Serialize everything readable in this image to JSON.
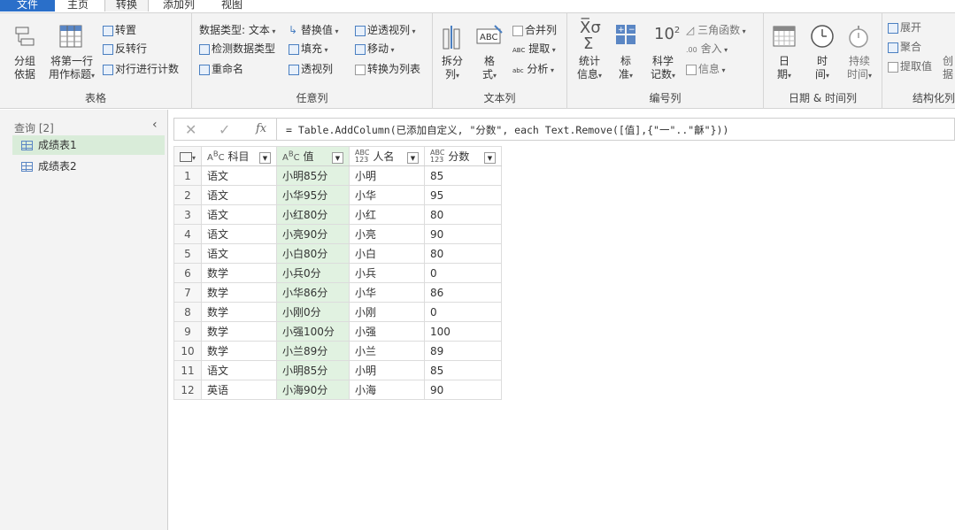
{
  "menu": {
    "file": "文件",
    "home": "主页",
    "transform": "转换",
    "add_column": "添加列",
    "view": "视图"
  },
  "ribbon": {
    "table_group": {
      "label": "表格",
      "group_by_1": "分组",
      "group_by_2": "依据",
      "first_row_1": "将第一行",
      "first_row_2": "用作标题",
      "transpose": "转置",
      "reverse_rows": "反转行",
      "count_rows": "对行进行计数"
    },
    "any_column_group": {
      "label": "任意列",
      "data_type": "数据类型: 文本",
      "detect_type": "检测数据类型",
      "rename": "重命名",
      "replace_values": "替换值",
      "fill": "填充",
      "pivot": "透视列",
      "unpivot": "逆透视列",
      "move": "移动",
      "to_list": "转换为列表"
    },
    "text_column_group": {
      "label": "文本列",
      "split_1": "拆分",
      "split_2": "列",
      "format_1": "格",
      "format_2": "式",
      "merge": "合并列",
      "extract": "提取",
      "parse": "分析"
    },
    "number_column_group": {
      "label": "编号列",
      "stats_1": "统计",
      "stats_2": "信息",
      "standard_1": "标",
      "standard_2": "准",
      "scientific_1": "科学",
      "scientific_2": "记数",
      "trig": "三角函数",
      "rounding": "舍入",
      "info": "信息"
    },
    "datetime_group": {
      "label": "日期 & 时间列",
      "date_1": "日",
      "date_2": "期",
      "time_1": "时",
      "time_2": "间",
      "duration_1": "持续",
      "duration_2": "时间"
    },
    "structured_group": {
      "label": "结构化列",
      "expand": "展开",
      "aggregate": "聚合",
      "extract_values": "提取值",
      "create_1": "创",
      "create_2": "据"
    }
  },
  "queries": {
    "header": "查询 [2]",
    "items": [
      "成绩表1",
      "成绩表2"
    ]
  },
  "formula": {
    "text": "= Table.AddColumn(已添加自定义, \"分数\", each Text.Remove([值],{\"一\"..\"龢\"}))"
  },
  "table": {
    "columns": [
      {
        "name": "科目",
        "type": "ABC"
      },
      {
        "name": "值",
        "type": "ABC"
      },
      {
        "name": "人名",
        "type": "ABC123"
      },
      {
        "name": "分数",
        "type": "ABC123"
      }
    ],
    "rows": [
      {
        "n": "1",
        "subject": "语文",
        "value": "小明85分",
        "name": "小明",
        "score": "85"
      },
      {
        "n": "2",
        "subject": "语文",
        "value": "小华95分",
        "name": "小华",
        "score": "95"
      },
      {
        "n": "3",
        "subject": "语文",
        "value": "小红80分",
        "name": "小红",
        "score": "80"
      },
      {
        "n": "4",
        "subject": "语文",
        "value": "小亮90分",
        "name": "小亮",
        "score": "90"
      },
      {
        "n": "5",
        "subject": "语文",
        "value": "小白80分",
        "name": "小白",
        "score": "80"
      },
      {
        "n": "6",
        "subject": "数学",
        "value": "小兵0分",
        "name": "小兵",
        "score": "0"
      },
      {
        "n": "7",
        "subject": "数学",
        "value": "小华86分",
        "name": "小华",
        "score": "86"
      },
      {
        "n": "8",
        "subject": "数学",
        "value": "小刚0分",
        "name": "小刚",
        "score": "0"
      },
      {
        "n": "9",
        "subject": "数学",
        "value": "小强100分",
        "name": "小强",
        "score": "100"
      },
      {
        "n": "10",
        "subject": "数学",
        "value": "小兰89分",
        "name": "小兰",
        "score": "89"
      },
      {
        "n": "11",
        "subject": "语文",
        "value": "小明85分",
        "name": "小明",
        "score": "85"
      },
      {
        "n": "12",
        "subject": "英语",
        "value": "小海90分",
        "name": "小海",
        "score": "90"
      }
    ]
  },
  "colors": {
    "file_tab": "#2a6fc9",
    "selected_column": "#e1f2e1",
    "selected_query": "#d9ecd9"
  }
}
